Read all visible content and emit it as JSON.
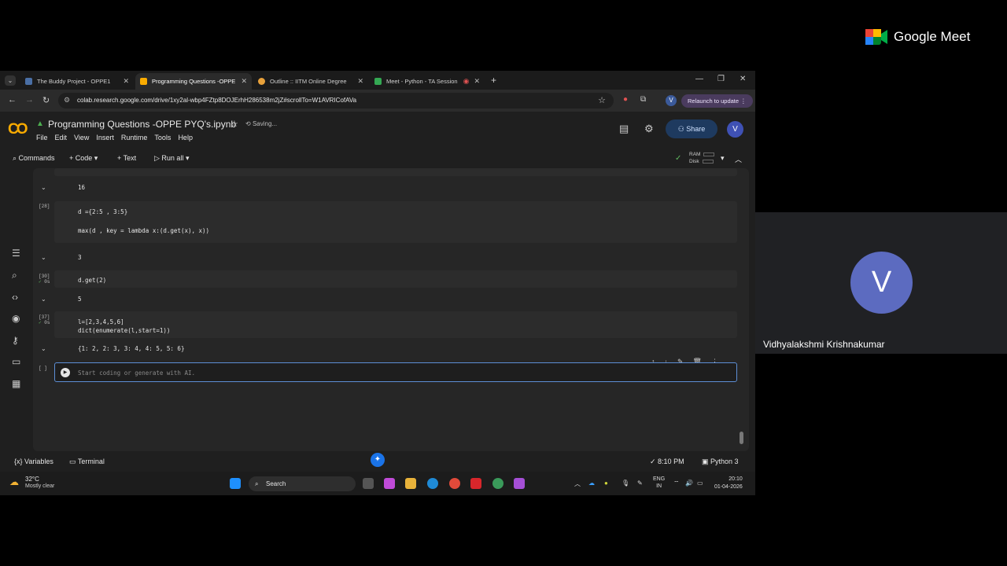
{
  "browser": {
    "tabs": [
      {
        "title": "The Buddy Project - OPPE1",
        "favicon_color": "#4a6fa5",
        "active": false
      },
      {
        "title": "Programming Questions -OPPE",
        "favicon_color": "#f9ab00",
        "active": true
      },
      {
        "title": "Outline :: IITM Online Degree",
        "favicon_color": "#e8a13b",
        "active": false
      },
      {
        "title": "Meet - Python - TA Session",
        "favicon_color": "#34a853",
        "active": false
      }
    ],
    "url": "colab.research.google.com/drive/1xy2al-wbp4FZtp8DOJErhH286538m2jZ#scrollTo=W1AVRICofAVa",
    "profile_initial": "V",
    "relaunch_label": "Relaunch to update"
  },
  "colab": {
    "logo": "CO",
    "notebook_title": "Programming Questions -OPPE PYQ's.ipynb",
    "save_status": "Saving...",
    "menu": [
      "File",
      "Edit",
      "View",
      "Insert",
      "Runtime",
      "Tools",
      "Help"
    ],
    "share_label": "Share",
    "user_initial": "V",
    "toolbar": {
      "commands": "Commands",
      "code": "+ Code",
      "text": "+ Text",
      "run_all": "Run all",
      "ram": "RAM",
      "disk": "Disk"
    }
  },
  "cells": [
    {
      "exec": "",
      "exec_time": "",
      "lines": [],
      "output": "16"
    },
    {
      "exec": "[28]",
      "exec_time": "",
      "lines": [
        "d ={2:5 , 3:5}",
        "",
        "max(d , key = lambda x:(d.get(x), x))"
      ],
      "output": "3"
    },
    {
      "exec": "[30]",
      "exec_time": "0s",
      "lines": [
        "d.get(2)"
      ],
      "output": "5"
    },
    {
      "exec": "[37]",
      "exec_time": "0s",
      "lines": [
        "l=[2,3,4,5,6]",
        "dict(enumerate(l,start=1))"
      ],
      "output": "{1: 2, 2: 3, 3: 4, 4: 5, 5: 6}"
    }
  ],
  "active_cell": {
    "exec": "[ ]",
    "placeholder": "Start coding or generate with AI."
  },
  "statusbar": {
    "variables": "Variables",
    "terminal": "Terminal",
    "time": "8:10 PM",
    "runtime": "Python 3"
  },
  "taskbar": {
    "temperature": "32°C",
    "weather": "Mostly clear",
    "search": "Search",
    "lang": "ENG",
    "region": "IN",
    "clock_time": "20:10",
    "clock_date": "01-04-2026"
  },
  "meet": {
    "logo_text": "Google Meet",
    "participant_initial": "V",
    "participant_name": "Vidhyalakshmi Krishnakumar",
    "avatar_color": "#5c6bc0"
  }
}
